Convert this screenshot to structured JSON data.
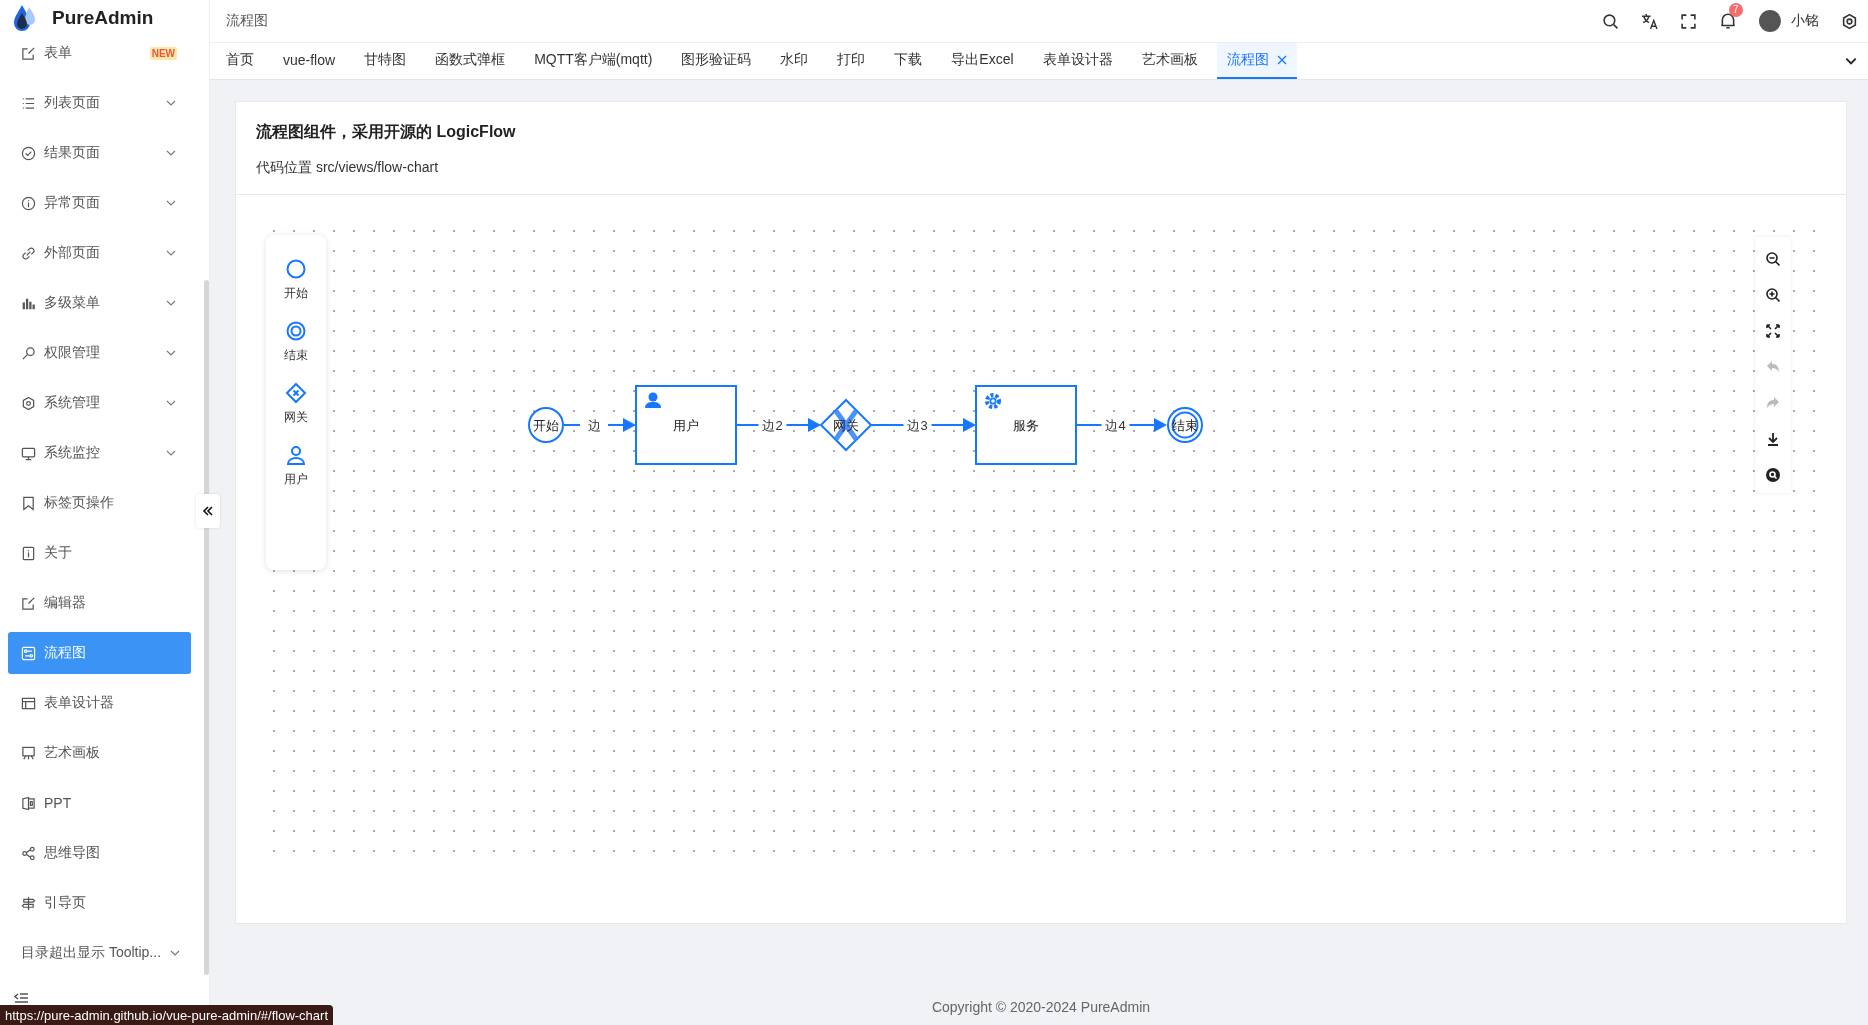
{
  "app": {
    "name": "PureAdmin"
  },
  "sidebar": {
    "items": [
      {
        "label": "表单",
        "badge": "NEW",
        "expandable": false,
        "selected": false
      },
      {
        "label": "列表页面",
        "expandable": true,
        "selected": false
      },
      {
        "label": "结果页面",
        "expandable": true,
        "selected": false
      },
      {
        "label": "异常页面",
        "expandable": true,
        "selected": false
      },
      {
        "label": "外部页面",
        "expandable": true,
        "selected": false
      },
      {
        "label": "多级菜单",
        "expandable": true,
        "selected": false
      },
      {
        "label": "权限管理",
        "expandable": true,
        "selected": false
      },
      {
        "label": "系统管理",
        "expandable": true,
        "selected": false
      },
      {
        "label": "系统监控",
        "expandable": true,
        "selected": false
      },
      {
        "label": "标签页操作",
        "expandable": false,
        "selected": false
      },
      {
        "label": "关于",
        "expandable": false,
        "selected": false
      },
      {
        "label": "编辑器",
        "expandable": false,
        "selected": false
      },
      {
        "label": "流程图",
        "expandable": false,
        "selected": true
      },
      {
        "label": "表单设计器",
        "expandable": false,
        "selected": false
      },
      {
        "label": "艺术画板",
        "expandable": false,
        "selected": false
      },
      {
        "label": "PPT",
        "expandable": false,
        "selected": false
      },
      {
        "label": "思维导图",
        "expandable": false,
        "selected": false
      },
      {
        "label": "引导页",
        "expandable": false,
        "selected": false
      },
      {
        "label": "目录超出显示 Tooltip...",
        "expandable": true,
        "selected": false
      }
    ]
  },
  "header": {
    "breadcrumb": "流程图",
    "notification_count": "7",
    "user": "小铭"
  },
  "tabs": [
    {
      "label": "首页",
      "selected": false
    },
    {
      "label": "vue-flow",
      "selected": false
    },
    {
      "label": "甘特图",
      "selected": false
    },
    {
      "label": "函数式弹框",
      "selected": false
    },
    {
      "label": "MQTT客户端(mqtt)",
      "selected": false
    },
    {
      "label": "图形验证码",
      "selected": false
    },
    {
      "label": "水印",
      "selected": false
    },
    {
      "label": "打印",
      "selected": false
    },
    {
      "label": "下载",
      "selected": false
    },
    {
      "label": "导出Excel",
      "selected": false
    },
    {
      "label": "表单设计器",
      "selected": false
    },
    {
      "label": "艺术画板",
      "selected": false
    },
    {
      "label": "流程图",
      "selected": true
    }
  ],
  "page": {
    "title": "流程图组件，采用开源的 LogicFlow",
    "code_location": "代码位置 src/views/flow-chart"
  },
  "palette": [
    {
      "kind": "start",
      "label": "开始"
    },
    {
      "kind": "end",
      "label": "结束"
    },
    {
      "kind": "gateway",
      "label": "网关"
    },
    {
      "kind": "user",
      "label": "用户"
    }
  ],
  "toolbar": [
    {
      "kind": "zoom-out",
      "disabled": false
    },
    {
      "kind": "zoom-in",
      "disabled": false
    },
    {
      "kind": "fit",
      "disabled": false
    },
    {
      "kind": "undo",
      "disabled": true
    },
    {
      "kind": "redo",
      "disabled": true
    },
    {
      "kind": "download",
      "disabled": false
    },
    {
      "kind": "minimap",
      "disabled": false
    }
  ],
  "diagram": {
    "nodes": [
      {
        "kind": "start",
        "label": "开始"
      },
      {
        "kind": "user",
        "label": "用户"
      },
      {
        "kind": "gateway",
        "label": "网关"
      },
      {
        "kind": "service",
        "label": "服务"
      },
      {
        "kind": "end",
        "label": "结束"
      }
    ],
    "edges": [
      {
        "label": "边"
      },
      {
        "label": "边2"
      },
      {
        "label": "边3"
      },
      {
        "label": "边4"
      }
    ]
  },
  "footer": "Copyright © 2020-2024 PureAdmin",
  "status_url": "https://pure-admin.github.io/vue-pure-admin/#/flow-chart"
}
